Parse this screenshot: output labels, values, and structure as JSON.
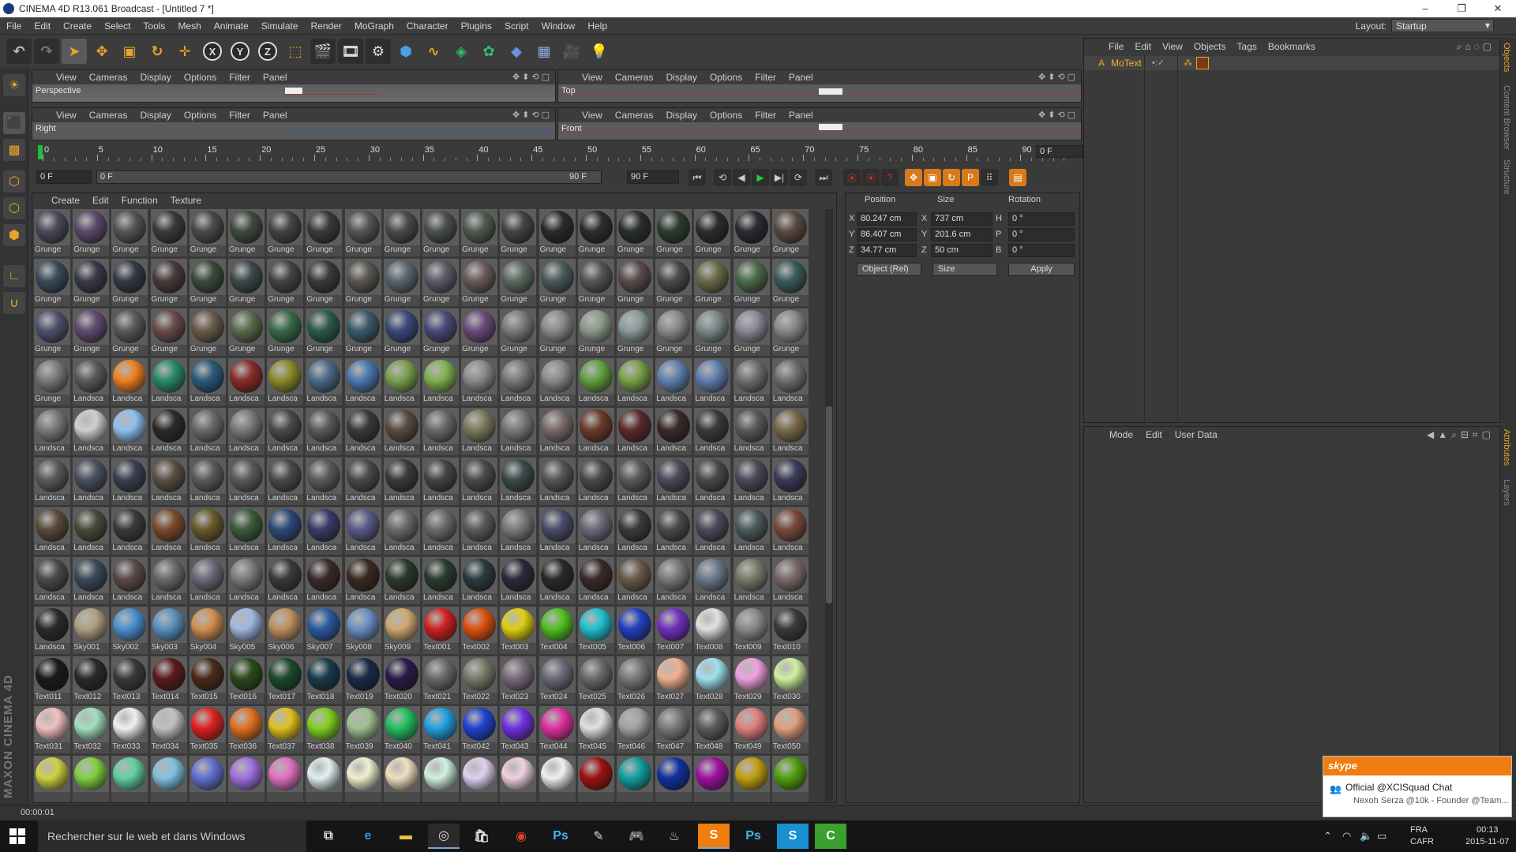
{
  "window": {
    "title": "CINEMA 4D R13.061 Broadcast - [Untitled 7 *]",
    "controls": [
      "–",
      "❐",
      "✕"
    ]
  },
  "menubar": {
    "items": [
      "File",
      "Edit",
      "Create",
      "Select",
      "Tools",
      "Mesh",
      "Animate",
      "Simulate",
      "Render",
      "MoGraph",
      "Character",
      "Plugins",
      "Script",
      "Window",
      "Help"
    ],
    "layout_label": "Layout:",
    "layout_value": "Startup"
  },
  "viewports": {
    "menu": [
      "View",
      "Cameras",
      "Display",
      "Options",
      "Filter",
      "Panel"
    ],
    "names": [
      "Perspective",
      "Top",
      "Right",
      "Front"
    ]
  },
  "timeline": {
    "ticks": [
      "0",
      "5",
      "10",
      "15",
      "20",
      "25",
      "30",
      "35",
      "40",
      "45",
      "50",
      "55",
      "60",
      "65",
      "70",
      "75",
      "80",
      "85",
      "90"
    ],
    "current_frame": "0 F",
    "start_field": "0 F",
    "range_start": "0 F",
    "range_end": "90 F",
    "end_field": "90 F"
  },
  "material_manager": {
    "menu": [
      "Create",
      "Edit",
      "Function",
      "Texture"
    ],
    "rows": [
      {
        "labels": [
          "Grunge",
          "Grunge",
          "Grunge",
          "Grunge",
          "Grunge",
          "Grunge",
          "Grunge",
          "Grunge",
          "Grunge",
          "Grunge",
          "Grunge",
          "Grunge",
          "Grunge",
          "Grunge",
          "Grunge",
          "Grunge",
          "Grunge",
          "Grunge",
          "Grunge",
          "Grunge"
        ],
        "colors": [
          "#4a4a5a",
          "#5a4a6a",
          "#555",
          "#3a3a3a",
          "#4a4a4a",
          "#3e4a3e",
          "#444",
          "#3a3a3a",
          "#555",
          "#4a4a4a",
          "#4a4f4a",
          "#505a50",
          "#444",
          "#2a2a2a",
          "#2c2c2c",
          "#2a2f2a",
          "#2c3a30",
          "#2c2c2c",
          "#2a2a30",
          "#5a4a40"
        ]
      },
      {
        "labels": [
          "Grunge",
          "Grunge",
          "Grunge",
          "Grunge",
          "Grunge",
          "Grunge",
          "Grunge",
          "Grunge",
          "Grunge",
          "Grunge",
          "Grunge",
          "Grunge",
          "Grunge",
          "Grunge",
          "Grunge",
          "Grunge",
          "Grunge",
          "Grunge",
          "Grunge",
          "Grunge"
        ],
        "colors": [
          "#3a4a5a",
          "#3a3a4a",
          "#333a44",
          "#4a3a3a",
          "#3a4a3a",
          "#3a4a4a",
          "#444",
          "#3a3a3a",
          "#5a5550",
          "#5a6570",
          "#5a5a6a",
          "#6a5a5a",
          "#5a6a60",
          "#4a5a5a",
          "#555",
          "#5a4a4a",
          "#4a4a4a",
          "#6a6a4a",
          "#4a6a4a",
          "#3a5a5a"
        ]
      },
      {
        "labels": [
          "Grunge",
          "Grunge",
          "Grunge",
          "Grunge",
          "Grunge",
          "Grunge",
          "Grunge",
          "Grunge",
          "Grunge",
          "Grunge",
          "Grunge",
          "Grunge",
          "Grunge",
          "Grunge",
          "Grunge",
          "Grunge",
          "Grunge",
          "Grunge",
          "Grunge",
          "Grunge"
        ],
        "colors": [
          "#505070",
          "#604a70",
          "#5a5a5a",
          "#6a4a4a",
          "#6a5a4a",
          "#5a6a4a",
          "#3a6a4a",
          "#2a5a4a",
          "#3a5a6a",
          "#3a4a7a",
          "#4a4a7a",
          "#6a4a7a",
          "#7a7a7a",
          "#8a8a8a",
          "#8a9a8a",
          "#8a9a9a",
          "#8a8a8a",
          "#7a8a8a",
          "#8a8a9a",
          "#8a8a8a"
        ]
      },
      {
        "labels": [
          "Grunge",
          "Landsca",
          "Landsca",
          "Landsca",
          "Landsca",
          "Landsca",
          "Landsca",
          "Landsca",
          "Landsca",
          "Landsca",
          "Landsca",
          "Landsca",
          "Landsca",
          "Landsca",
          "Landsca",
          "Landsca",
          "Landsca",
          "Landsca",
          "Landsca",
          "Landsca"
        ],
        "colors": [
          "#7a7a7a",
          "#5a5a5a",
          "#f08020",
          "#2a8a6a",
          "#2a5a7a",
          "#8a2a2a",
          "#8a8a2a",
          "#4a6a8a",
          "#4a78b0",
          "#7aa050",
          "#80b050",
          "#8a8a8a",
          "#7a7a7a",
          "#8a8a8a",
          "#60a040",
          "#78a048",
          "#6080b0",
          "#6080b0",
          "#707070",
          "#707070"
        ]
      },
      {
        "labels": [
          "Landsca",
          "Landsca",
          "Landsca",
          "Landsca",
          "Landsca",
          "Landsca",
          "Landsca",
          "Landsca",
          "Landsca",
          "Landsca",
          "Landsca",
          "Landsca",
          "Landsca",
          "Landsca",
          "Landsca",
          "Landsca",
          "Landsca",
          "Landsca",
          "Landsca",
          "Landsca"
        ],
        "colors": [
          "#7a7a7a",
          "#cfcfcf",
          "#8ec0f0",
          "#2a2a2a",
          "#6a6a6a",
          "#7a7a7a",
          "#4a4a4a",
          "#5a5a5a",
          "#3a3a3a",
          "#5a4a40",
          "#6a6a6a",
          "#7a7a5a",
          "#7a7a7a",
          "#7a6a6a",
          "#6a3a2a",
          "#5a2a2a",
          "#3a2a2a",
          "#3a3a3a",
          "#5a5a5a",
          "#7a6a4a"
        ]
      },
      {
        "labels": [
          "Landsca",
          "Landsca",
          "Landsca",
          "Landsca",
          "Landsca",
          "Landsca",
          "Landsca",
          "Landsca",
          "Landsca",
          "Landsca",
          "Landsca",
          "Landsca",
          "Landsca",
          "Landsca",
          "Landsca",
          "Landsca",
          "Landsca",
          "Landsca",
          "Landsca",
          "Landsca"
        ],
        "colors": [
          "#5a5a5a",
          "#4a5060",
          "#3a4050",
          "#5a5040",
          "#5a5a5a",
          "#5a5a5a",
          "#4a4a4a",
          "#5a5a5a",
          "#4a4a4a",
          "#3a3a3a",
          "#444",
          "#4a4a4a",
          "#3a4a4a",
          "#555",
          "#4a4a4a",
          "#5a5a5a",
          "#4a4a5a",
          "#4a4a4a",
          "#4a4a5a",
          "#3a3a5a"
        ]
      },
      {
        "labels": [
          "Landsca",
          "Landsca",
          "Landsca",
          "Landsca",
          "Landsca",
          "Landsca",
          "Landsca",
          "Landsca",
          "Landsca",
          "Landsca",
          "Landsca",
          "Landsca",
          "Landsca",
          "Landsca",
          "Landsca",
          "Landsca",
          "Landsca",
          "Landsca",
          "Landsca",
          "Landsca"
        ],
        "colors": [
          "#5a4a3a",
          "#4a4a3a",
          "#3a3a3a",
          "#7a4a2a",
          "#6a5a2a",
          "#3a5a3a",
          "#2a4a7a",
          "#3a3a6a",
          "#5a5a8a",
          "#6a6a6a",
          "#6a6a6a",
          "#5a5a5a",
          "#7a7a7a",
          "#4a4a6a",
          "#6a6a7a",
          "#3a3a3a",
          "#4a4a4a",
          "#4a4a5a",
          "#4a5a5a",
          "#7a4a3a"
        ]
      },
      {
        "labels": [
          "Landsca",
          "Landsca",
          "Landsca",
          "Landsca",
          "Landsca",
          "Landsca",
          "Landsca",
          "Landsca",
          "Landsca",
          "Landsca",
          "Landsca",
          "Landsca",
          "Landsca",
          "Landsca",
          "Landsca",
          "Landsca",
          "Landsca",
          "Landsca",
          "Landsca",
          "Landsca"
        ],
        "colors": [
          "#4a4a4a",
          "#3a4a5a",
          "#5a4a4a",
          "#6a6a6a",
          "#6a6a7a",
          "#7a7a7a",
          "#3a3a3a",
          "#3a2a2a",
          "#3a2a20",
          "#2a3a2a",
          "#2a3a30",
          "#2a3a40",
          "#2a2a3a",
          "#2a2a2a",
          "#3a2a2a",
          "#6a5a4a",
          "#7a7a7a",
          "#6a7a8a",
          "#7a7a6a",
          "#7a6a6a"
        ]
      },
      {
        "labels": [
          "Landsca",
          "Sky001",
          "Sky002",
          "Sky003",
          "Sky004",
          "Sky005",
          "Sky006",
          "Sky007",
          "Sky008",
          "Sky009",
          "Text001",
          "Text002",
          "Text003",
          "Text004",
          "Text005",
          "Text006",
          "Text007",
          "Text008",
          "Text009",
          "Text010"
        ],
        "colors": [
          "#2a2a2a",
          "#b0a080",
          "#4a90d0",
          "#5a90c0",
          "#d09050",
          "#a0b8e0",
          "#c09060",
          "#2a5aa0",
          "#6a90c0",
          "#d0a870",
          "#d02020",
          "#e05010",
          "#e0d010",
          "#50c020",
          "#20c0d0",
          "#2040c0",
          "#7030c0",
          "#e0e0e0",
          "#8a8a8a",
          "#3a3a3a"
        ]
      },
      {
        "labels": [
          "Text011",
          "Text012",
          "Text013",
          "Text014",
          "Text015",
          "Text016",
          "Text017",
          "Text018",
          "Text019",
          "Text020",
          "Text021",
          "Text022",
          "Text023",
          "Text024",
          "Text025",
          "Text026",
          "Text027",
          "Text028",
          "Text029",
          "Text030"
        ],
        "colors": [
          "#1a1a1a",
          "#2a2a2a",
          "#3a3a3a",
          "#5a1a1a",
          "#4a2a1a",
          "#2a4a1a",
          "#1a4a2a",
          "#1a3a4a",
          "#1a2a4a",
          "#2a1a4a",
          "#6a6a6a",
          "#7a7a6a",
          "#7a6a7a",
          "#6a6a7a",
          "#6a6a6a",
          "#7a7a7a",
          "#f0b090",
          "#a0e0f0",
          "#f0a0e0",
          "#d0f0a0"
        ]
      },
      {
        "labels": [
          "Text031",
          "Text032",
          "Text033",
          "Text034",
          "Text035",
          "Text036",
          "Text037",
          "Text038",
          "Text039",
          "Text040",
          "Text041",
          "Text042",
          "Text043",
          "Text044",
          "Text045",
          "Text046",
          "Text047",
          "Text048",
          "Text049",
          "Text050"
        ],
        "colors": [
          "#f0c0c0",
          "#a0e0c0",
          "#f0f0f0",
          "#c0c0c0",
          "#e02020",
          "#e07020",
          "#e0c020",
          "#80d020",
          "#a0c090",
          "#20c060",
          "#20a0e0",
          "#2040d0",
          "#7030e0",
          "#e030a0",
          "#e0e0e0",
          "#a0a0a0",
          "#7a7a7a",
          "#5a5a5a",
          "#e08080",
          "#e0a080"
        ]
      },
      {
        "labels": [
          "",
          "",
          "",
          "",
          "",
          "",
          "",
          "",
          "",
          "",
          "",
          "",
          "",
          "",
          "",
          "",
          "",
          "",
          "",
          ""
        ],
        "colors": [
          "#d0d040",
          "#80d040",
          "#60d0a0",
          "#80c0e0",
          "#6070d0",
          "#a070e0",
          "#e070c0",
          "#e0f0f0",
          "#f0f0d0",
          "#f0e0c0",
          "#d0f0e0",
          "#e0d0f0",
          "#f0d0e0",
          "#f0f0f0",
          "#a01010",
          "#10a0a0",
          "#1030a0",
          "#a010a0",
          "#c0a010",
          "#50a010"
        ]
      }
    ]
  },
  "coordinates": {
    "headers": [
      "Position",
      "Size",
      "Rotation"
    ],
    "rows": [
      {
        "axis": "X",
        "pos": "80.247 cm",
        "size_axis": "X",
        "size": "737 cm",
        "rot_axis": "H",
        "rot": "0 °"
      },
      {
        "axis": "Y",
        "pos": "86.407 cm",
        "size_axis": "Y",
        "size": "201.6 cm",
        "rot_axis": "P",
        "rot": "0 °"
      },
      {
        "axis": "Z",
        "pos": "34.77 cm",
        "size_axis": "Z",
        "size": "50 cm",
        "rot_axis": "B",
        "rot": "0 °"
      }
    ],
    "mode": "Object (Rel)",
    "size_mode": "Size",
    "apply": "Apply"
  },
  "object_manager": {
    "menu": [
      "File",
      "Edit",
      "View",
      "Objects",
      "Tags",
      "Bookmarks"
    ],
    "object_name": "MoText"
  },
  "attribute_manager": {
    "menu": [
      "Mode",
      "Edit",
      "User Data"
    ]
  },
  "side_tabs": [
    "Objects",
    "Content Browser",
    "Structure",
    "Attributes",
    "Layers"
  ],
  "status": {
    "text": "00:00:01"
  },
  "skype": {
    "logo": "skype",
    "title": "Official @XCISquad Chat",
    "subtitle": "Nexoh Serza @10k - Founder @Team..."
  },
  "taskbar": {
    "search_placeholder": "Rechercher sur le web et dans Windows",
    "lang_top": "FRA",
    "lang_bottom": "CAFR",
    "time": "00:13",
    "date": "2015-11-07"
  },
  "maxon_logo": "MAXON CINEMA 4D",
  "colors": {
    "accent": "#e8a32a",
    "play": "#22cc33",
    "record": "#e03030",
    "skype": "#f07d10"
  }
}
